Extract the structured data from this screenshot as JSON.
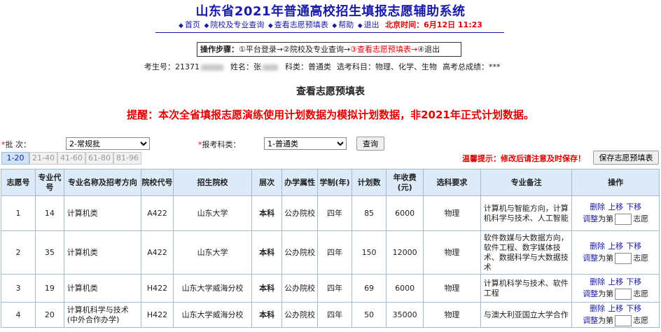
{
  "header": {
    "title": "山东省2021年普通高校招生填报志愿辅助系统",
    "nav": [
      {
        "label": "首页"
      },
      {
        "label": "院校及专业查询"
      },
      {
        "label": "查看志愿预填表"
      },
      {
        "label": "帮助"
      },
      {
        "label": "退出"
      }
    ],
    "time_label": "北京时间：6月12日 11:23"
  },
  "steps": {
    "prefix": "操作步骤：",
    "step1": "①平台登录→",
    "step2": "②院校及专业查询→",
    "step3": "③查看志愿预填表→",
    "step4": "④退出"
  },
  "candidate": {
    "id_label": "考生号：",
    "id_value": "21371",
    "name_label": "姓名：",
    "name_value": "张",
    "subject_label": "科类：",
    "subject_value": "普通类",
    "elective_label": "选考科目：",
    "elective_value": "物理、化学、生物",
    "score_label": "高考总成绩：",
    "score_value": "***"
  },
  "page_title": "查看志愿预填表",
  "notice": "提醒：本次全省填报志愿演练使用计划数据为模拟计划数据，非2021年正式计划数据。",
  "filters": {
    "batch_label": "批  次：",
    "batch_value": "2-常规批",
    "subject_label": "报考科类：",
    "subject_value": "1-普通类",
    "query_button": "查询"
  },
  "pages": [
    {
      "label": "1-20",
      "active": true
    },
    {
      "label": "21-40",
      "active": false
    },
    {
      "label": "41-60",
      "active": false
    },
    {
      "label": "61-80",
      "active": false
    },
    {
      "label": "81-96",
      "active": false
    }
  ],
  "warm_tip": "温馨提示：修改后请注意及时保存！",
  "save_button": "保存志愿预填表",
  "table": {
    "headers": [
      "志愿号",
      "专业代号",
      "专业名称及招考方向",
      "院校代号",
      "招生院校",
      "层次",
      "办学属性",
      "学制(年)",
      "计划数",
      "年收费(元)",
      "选科要求",
      "专业备注",
      "操作"
    ],
    "rows": [
      {
        "no": "1",
        "major_code": "14",
        "major_name": "计算机类",
        "school_code": "A422",
        "school": "山东大学",
        "level": "本科",
        "nature": "公办院校",
        "years": "四年",
        "plan": "85",
        "fee": "6000",
        "require": "物理",
        "remark": "计算机与智能方向，计算机科学与技术、人工智能"
      },
      {
        "no": "2",
        "major_code": "35",
        "major_name": "计算机类",
        "school_code": "A422",
        "school": "山东大学",
        "level": "本科",
        "nature": "公办院校",
        "years": "四年",
        "plan": "150",
        "fee": "12000",
        "require": "物理",
        "remark": "软件数媒与大数据方向，软件工程、数字媒体技术、数据科学与大数据技术"
      },
      {
        "no": "3",
        "major_code": "19",
        "major_name": "计算机类",
        "school_code": "H422",
        "school": "山东大学威海分校",
        "level": "本科",
        "nature": "公办院校",
        "years": "四年",
        "plan": "69",
        "fee": "6000",
        "require": "物理",
        "remark": "计算机科学与技术、软件工程"
      },
      {
        "no": "4",
        "major_code": "20",
        "major_name": "计算机科学与技术(中外合作办学)",
        "school_code": "H422",
        "school": "山东大学威海分校",
        "level": "本科",
        "nature": "公办院校",
        "years": "四年",
        "plan": "50",
        "fee": "35000",
        "require": "物理",
        "remark": "与澳大利亚国立大学合作"
      }
    ],
    "op_labels": {
      "delete": "删除",
      "up": "上移",
      "down": "下移",
      "adjust": "调整",
      "to": "为第",
      "suffix": "志愿"
    }
  }
}
